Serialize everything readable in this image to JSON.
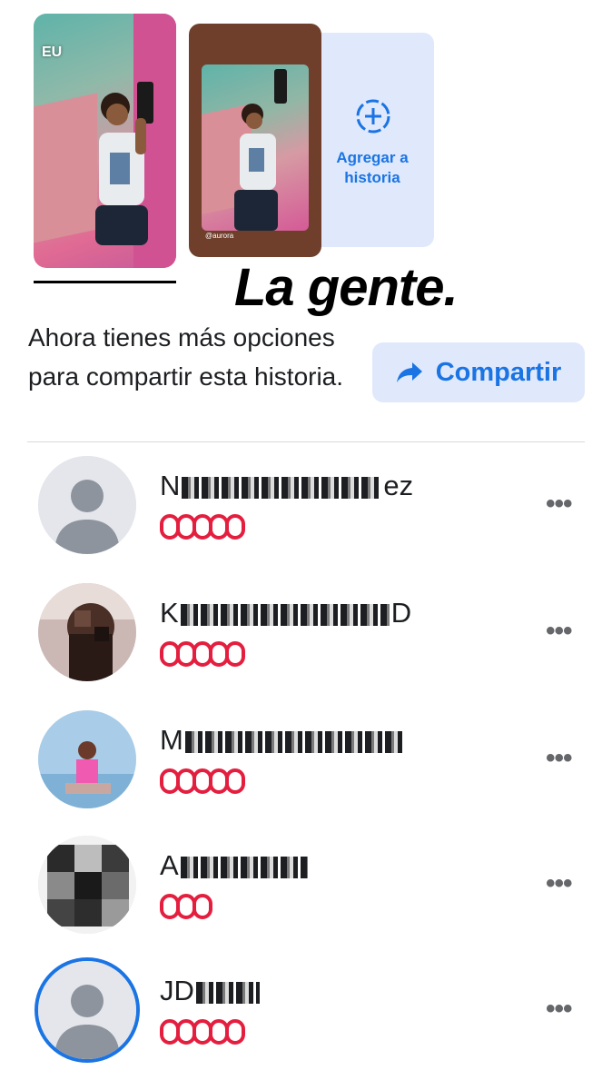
{
  "stories": {
    "main_label": "EU",
    "preview_caption": "@aurora",
    "add_label": "Agregar a historia"
  },
  "title": "La gente.",
  "share": {
    "info": "Ahora tienes más opciones para compartir esta historia.",
    "button_label": "Compartir"
  },
  "people": [
    {
      "name_start": "N",
      "name_end": "ez",
      "hearts": 5
    },
    {
      "name_start": "K",
      "name_end": "D",
      "hearts": 5
    },
    {
      "name_start": "M",
      "name_end": "",
      "hearts": 5
    },
    {
      "name_start": "A",
      "name_end": "",
      "hearts": 3
    },
    {
      "name_start": "JD",
      "name_end": "",
      "hearts": 5
    }
  ],
  "more_label": "•••",
  "colors": {
    "accent": "#1b74e4",
    "heart": "#e41e3f",
    "button_bg": "#dfe9fb"
  }
}
